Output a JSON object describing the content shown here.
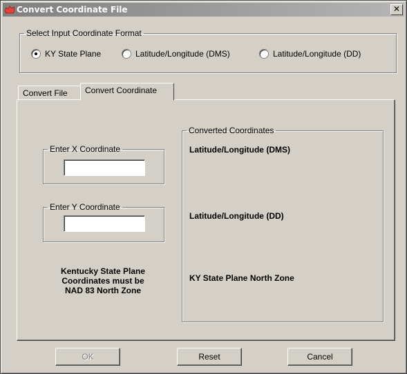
{
  "window": {
    "title": "Convert Coordinate File",
    "close_glyph": "✕",
    "icon": "app-logo-icon"
  },
  "format_group": {
    "legend": "Select Input Coordinate Format",
    "options": [
      {
        "label": "KY State Plane",
        "checked": true
      },
      {
        "label": "Latitude/Longitude (DMS)",
        "checked": false
      },
      {
        "label": "Latitude/Longitude (DD)",
        "checked": false
      }
    ]
  },
  "tabs": [
    {
      "label": "Convert File",
      "active": false
    },
    {
      "label": "Convert Coordinate",
      "active": true
    }
  ],
  "x_group": {
    "legend": "Enter X Coordinate",
    "value": ""
  },
  "y_group": {
    "legend": "Enter Y Coordinate",
    "value": ""
  },
  "note": [
    "Kentucky State Plane",
    "Coordinates must be",
    "NAD 83 North Zone"
  ],
  "converted_group": {
    "legend": "Converted Coordinates",
    "labels": [
      "Latitude/Longitude (DMS)",
      "Latitude/Longitude (DD)",
      "KY State Plane North Zone"
    ]
  },
  "buttons": {
    "ok": "OK",
    "reset": "Reset",
    "cancel": "Cancel"
  },
  "colors": {
    "face": "#d4d0c8",
    "titlebar_inactive": "#808080",
    "disabled_text": "#808080"
  }
}
